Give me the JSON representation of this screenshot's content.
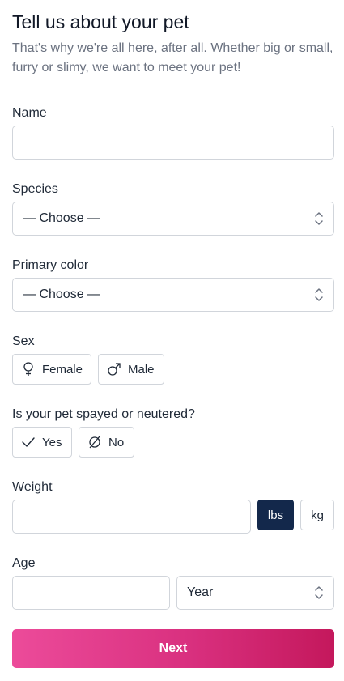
{
  "header": {
    "title": "Tell us about your pet",
    "intro": "That's why we're all here, after all. Whether big or small, furry or slimy, we want to meet your pet!"
  },
  "form": {
    "name": {
      "label": "Name",
      "value": ""
    },
    "species": {
      "label": "Species",
      "selected": "— Choose —"
    },
    "primary_color": {
      "label": "Primary color",
      "selected": "— Choose —"
    },
    "sex": {
      "label": "Sex",
      "options": [
        {
          "label": "Female",
          "icon": "female-icon"
        },
        {
          "label": "Male",
          "icon": "male-icon"
        }
      ]
    },
    "spayed": {
      "label": "Is your pet spayed or neutered?",
      "options": [
        {
          "label": "Yes",
          "icon": "check-icon"
        },
        {
          "label": "No",
          "icon": "empty-set-icon"
        }
      ]
    },
    "weight": {
      "label": "Weight",
      "value": "",
      "units": [
        {
          "label": "lbs",
          "active": true
        },
        {
          "label": "kg",
          "active": false
        }
      ]
    },
    "age": {
      "label": "Age",
      "value": "",
      "unit_selected": "Year"
    }
  },
  "actions": {
    "next_label": "Next"
  },
  "colors": {
    "accent_start": "#ec4b9a",
    "accent_end": "#c4185c",
    "unit_active": "#13284b",
    "border": "#d1d5db",
    "muted_text": "#6b7280"
  }
}
